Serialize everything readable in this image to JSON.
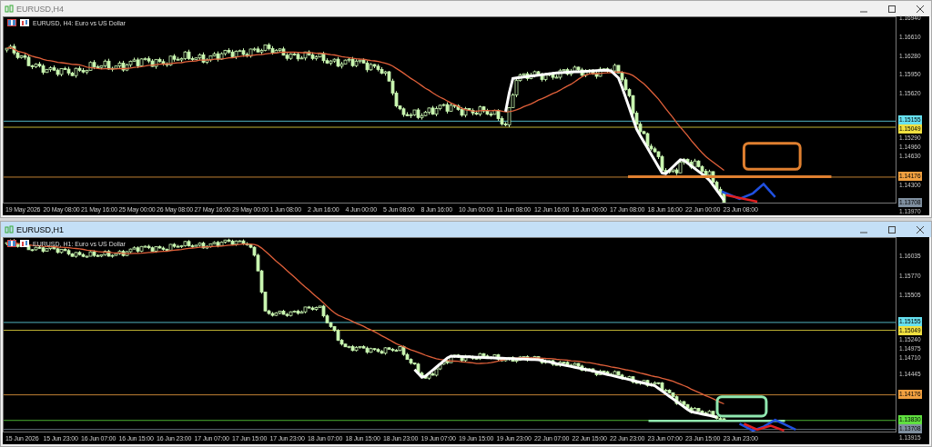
{
  "windows": [
    {
      "title": "EURUSD,H4",
      "active": false,
      "chart_label": "EURUSD, H4:  Euro vs US Dollar",
      "price_ticks": [
        "1.16940",
        "1.16610",
        "1.16280",
        "1.15950",
        "1.15620",
        "1.15290",
        "1.14960",
        "1.14630",
        "1.14300",
        "1.13970"
      ],
      "price_tags": [
        {
          "text": "1.15155",
          "color": "#66e0f0"
        },
        {
          "text": "1.15049",
          "color": "#f0e040"
        },
        {
          "text": "1.14176",
          "color": "#f0a040"
        },
        {
          "text": "1.13708",
          "color": "#8090a0"
        }
      ],
      "time_labels": [
        "19 May 2026",
        "20 May 08:00",
        "21 May 16:00",
        "25 May 00:00",
        "26 May 08:00",
        "27 May 16:00",
        "29 May 00:00",
        "1 Jun 08:00",
        "2 Jun 16:00",
        "4 Jun 00:00",
        "5 Jun 08:00",
        "8 Jun 16:00",
        "10 Jun 00:00",
        "11 Jun 08:00",
        "12 Jun 16:00",
        "16 Jun 00:00",
        "17 Jun 08:00",
        "18 Jun 16:00",
        "22 Jun 00:00",
        "23 Jun 08:00"
      ]
    },
    {
      "title": "EURUSD,H1",
      "active": true,
      "chart_label": "EURUSD, H1:  Euro vs US Dollar",
      "price_ticks": [
        "1.16035",
        "1.15770",
        "1.15505",
        "1.15240",
        "1.14975",
        "1.14710",
        "1.14445",
        "1.13915"
      ],
      "price_tags": [
        {
          "text": "1.15155",
          "color": "#66e0f0"
        },
        {
          "text": "1.15049",
          "color": "#f0e040"
        },
        {
          "text": "1.14176",
          "color": "#f0a040"
        },
        {
          "text": "1.13830",
          "color": "#60e040"
        },
        {
          "text": "1.13708",
          "color": "#8090a0"
        }
      ],
      "time_labels": [
        "15 Jun 2026",
        "15 Jun 23:00",
        "16 Jun 07:00",
        "16 Jun 15:00",
        "16 Jun 23:00",
        "17 Jun 07:00",
        "17 Jun 15:00",
        "17 Jun 23:00",
        "18 Jun 07:00",
        "18 Jun 15:00",
        "18 Jun 23:00",
        "19 Jun 07:00",
        "19 Jun 15:00",
        "19 Jun 23:00",
        "22 Jun 07:00",
        "22 Jun 15:00",
        "22 Jun 23:00",
        "23 Jun 07:00",
        "23 Jun 15:00",
        "23 Jun 23:00"
      ]
    }
  ]
}
